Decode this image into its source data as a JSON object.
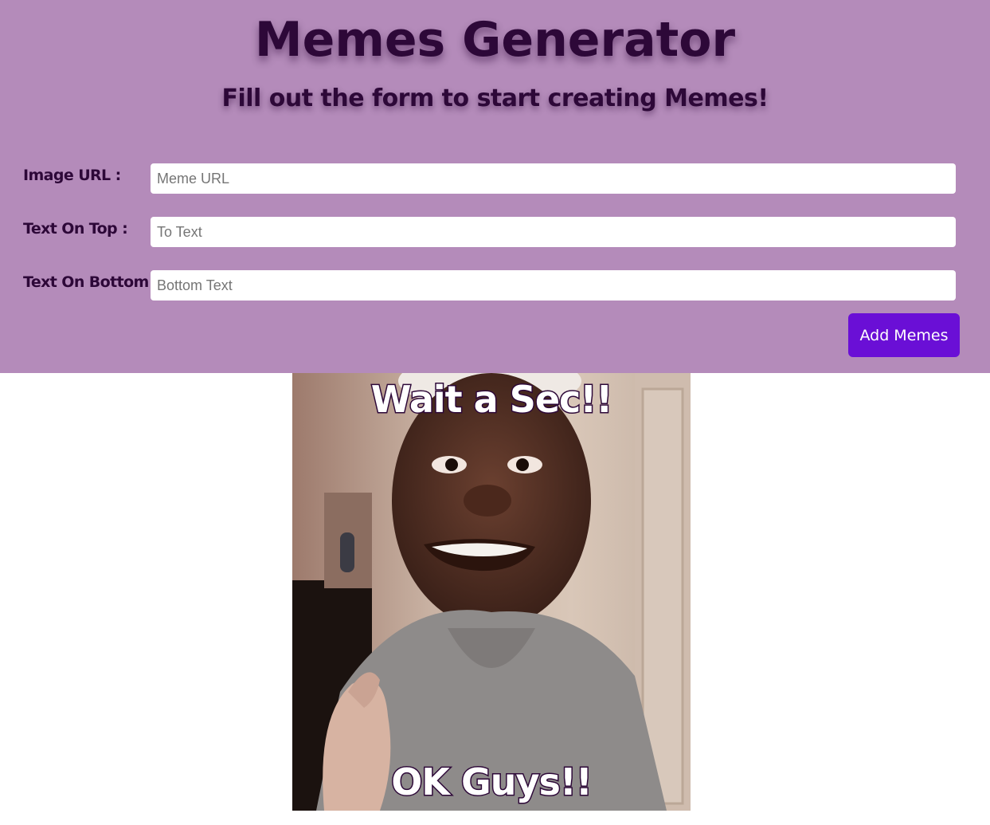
{
  "header": {
    "title": "Memes Generator",
    "subtitle": "Fill out the form to start creating Memes!",
    "background_color": "#b48bba",
    "text_color": "#2d0838"
  },
  "form": {
    "image_url": {
      "label": "Image URL :",
      "placeholder": "Meme URL",
      "value": ""
    },
    "text_top": {
      "label": "Text On Top :",
      "placeholder": "To Text",
      "value": ""
    },
    "text_bottom": {
      "label": "Text On Bottom :",
      "placeholder": "Bottom Text",
      "value": ""
    },
    "submit_label": "Add Memes",
    "submit_color": "#6a0fd6"
  },
  "memes": [
    {
      "top_text": "Wait a Sec!!",
      "bottom_text": "OK Guys!!"
    }
  ]
}
